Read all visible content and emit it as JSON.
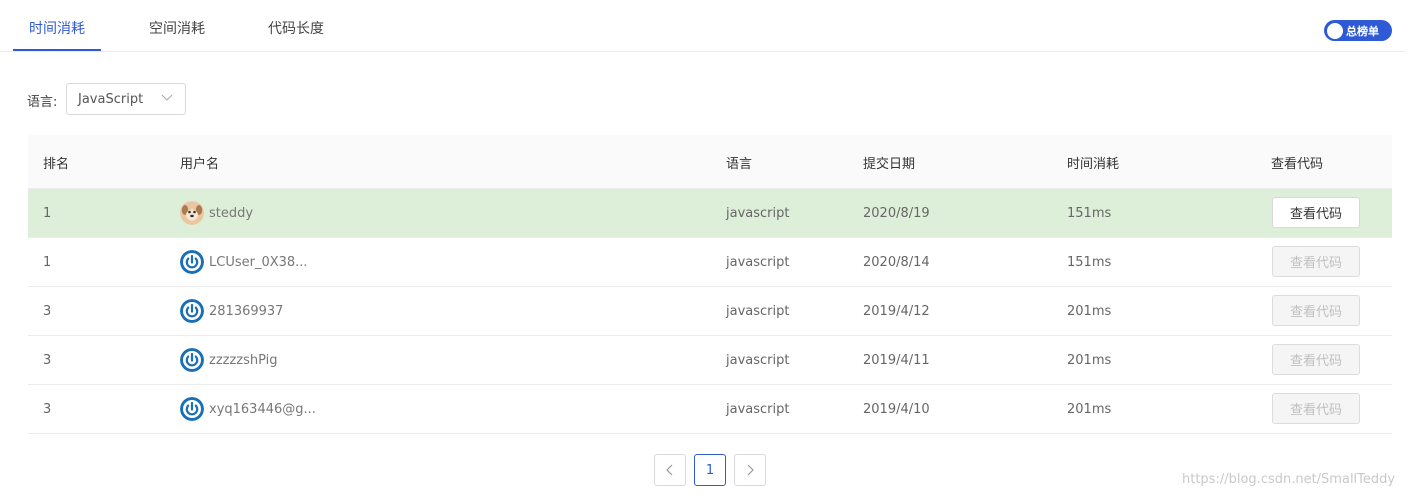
{
  "tabs": [
    {
      "label": "时间消耗",
      "active": true
    },
    {
      "label": "空间消耗",
      "active": false
    },
    {
      "label": "代码长度",
      "active": false
    }
  ],
  "toggle": {
    "label": "总榜单",
    "on": true
  },
  "filter": {
    "label": "语言:",
    "value": "JavaScript"
  },
  "table": {
    "headers": {
      "rank": "排名",
      "user": "用户名",
      "lang": "语言",
      "date": "提交日期",
      "time": "时间消耗",
      "code": "查看代码"
    },
    "rows": [
      {
        "rank": "1",
        "user": "steddy",
        "avatar": "dog-avatar",
        "lang": "javascript",
        "date": "2020/8/19",
        "time": "151ms",
        "button": "查看代码",
        "enabled": true,
        "highlight": true
      },
      {
        "rank": "1",
        "user": "LCUser_0X38...",
        "avatar": "power-avatar",
        "lang": "javascript",
        "date": "2020/8/14",
        "time": "151ms",
        "button": "查看代码",
        "enabled": false,
        "highlight": false
      },
      {
        "rank": "3",
        "user": "281369937",
        "avatar": "power-avatar",
        "lang": "javascript",
        "date": "2019/4/12",
        "time": "201ms",
        "button": "查看代码",
        "enabled": false,
        "highlight": false
      },
      {
        "rank": "3",
        "user": "zzzzzshPig",
        "avatar": "power-avatar",
        "lang": "javascript",
        "date": "2019/4/11",
        "time": "201ms",
        "button": "查看代码",
        "enabled": false,
        "highlight": false
      },
      {
        "rank": "3",
        "user": "xyq163446@g...",
        "avatar": "power-avatar",
        "lang": "javascript",
        "date": "2019/4/10",
        "time": "201ms",
        "button": "查看代码",
        "enabled": false,
        "highlight": false
      }
    ]
  },
  "pagination": {
    "current": "1",
    "prev_icon": "chevron-left-icon",
    "next_icon": "chevron-right-icon"
  },
  "watermark": "https://blog.csdn.net/SmallTeddy",
  "colors": {
    "accent": "#2f5ad6",
    "highlight_row": "#deefd9",
    "power_avatar": "#1a6fb5"
  }
}
